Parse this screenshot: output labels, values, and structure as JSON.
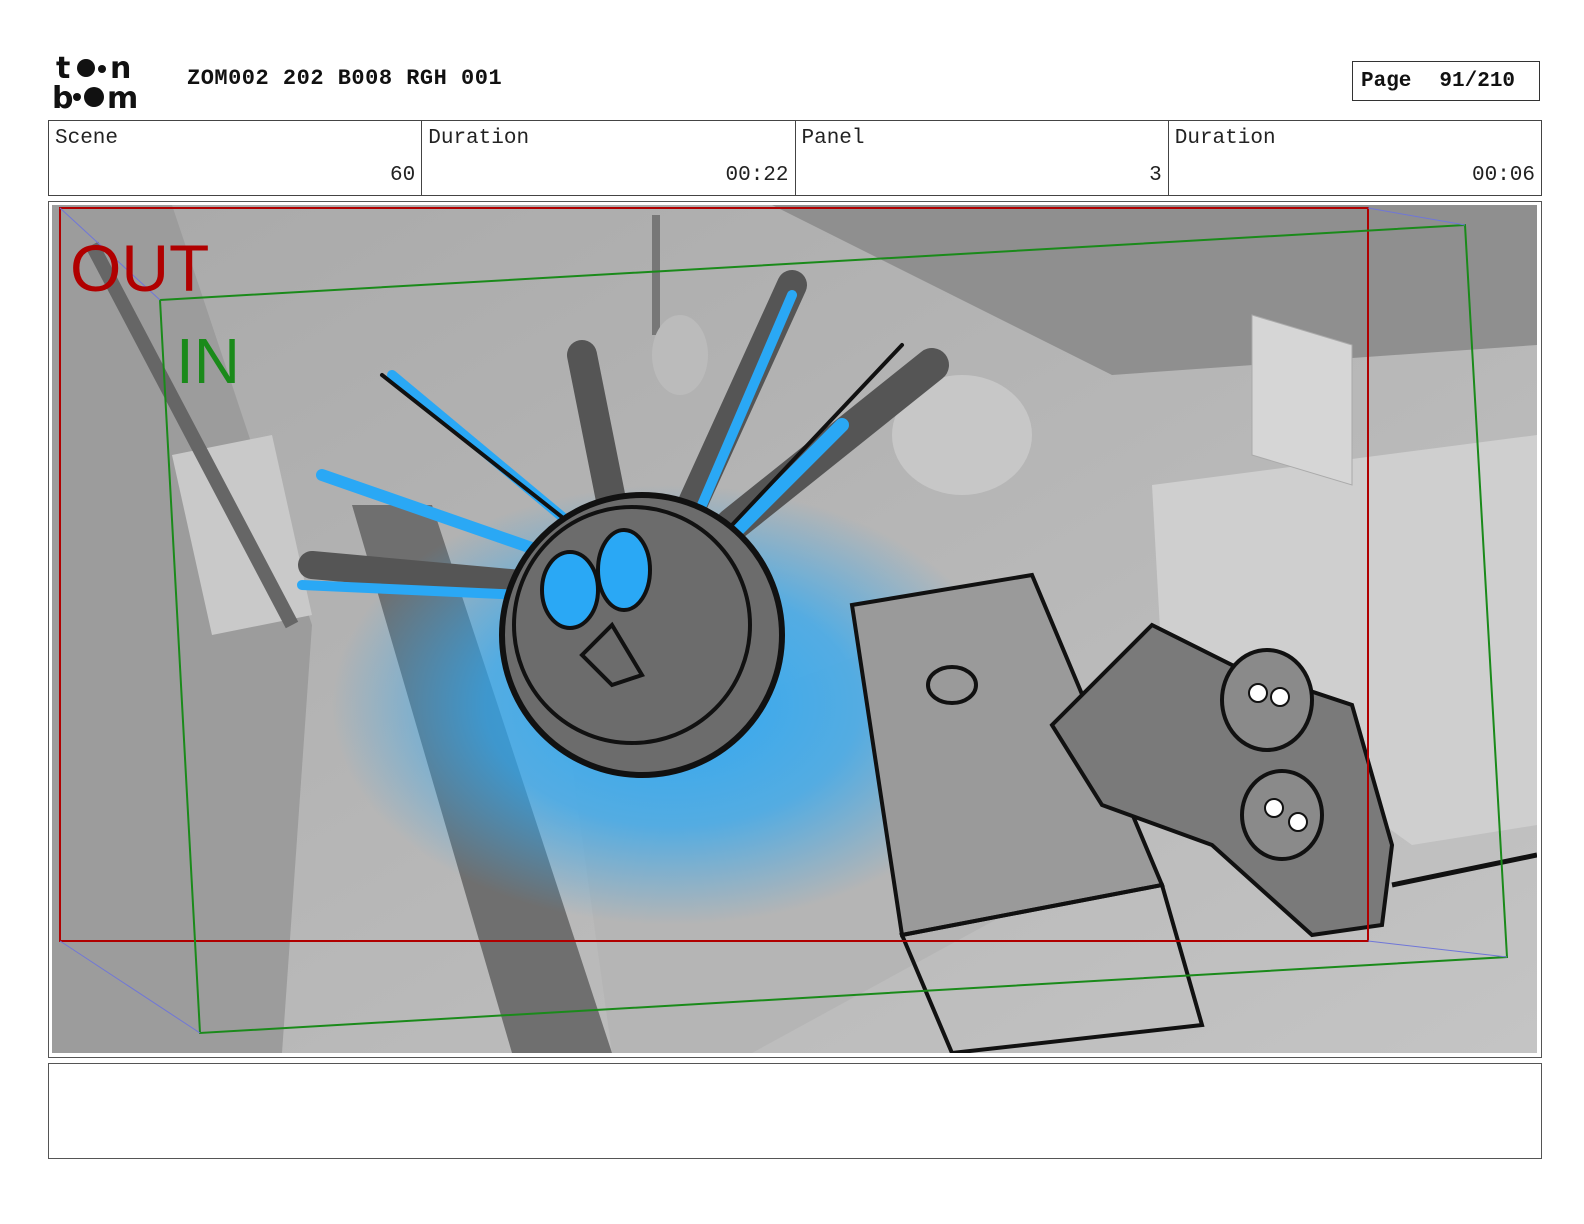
{
  "header": {
    "logo_text_top": "toon",
    "logo_text_bottom": "boom",
    "document_title": "ZOM002 202 B008 RGH 001",
    "page_label": "Page",
    "page_value": "91/210"
  },
  "info": {
    "scene_label": "Scene",
    "scene_value": "60",
    "scene_duration_label": "Duration",
    "scene_duration_value": "00:22",
    "panel_label": "Panel",
    "panel_value": "3",
    "panel_duration_label": "Duration",
    "panel_duration_value": "00:06"
  },
  "panel": {
    "out_label": "OUT",
    "in_label": "IN",
    "out_color": "#b00000",
    "in_color": "#1a8a1a",
    "accent_blue": "#2aa8f5"
  },
  "notes": {
    "text": ""
  }
}
